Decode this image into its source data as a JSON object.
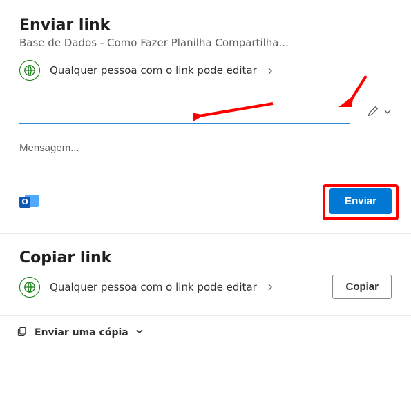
{
  "send_section": {
    "title": "Enviar link",
    "doc_name": "Base de Dados - Como Fazer Planilha Compartilha...",
    "permission_text": "Qualquer pessoa com o link pode editar",
    "recipient_placeholder": "",
    "message_placeholder": "Mensagem...",
    "send_label": "Enviar",
    "outlook_label": "O"
  },
  "copy_section": {
    "title": "Copiar link",
    "permission_text": "Qualquer pessoa com o link pode editar",
    "copy_label": "Copiar"
  },
  "footer": {
    "send_copy_label": "Enviar uma cópia"
  },
  "colors": {
    "accent": "#0078d4",
    "highlight": "#ff0000",
    "link_underline": "#2b88d8",
    "globe_green": "#107c10"
  }
}
